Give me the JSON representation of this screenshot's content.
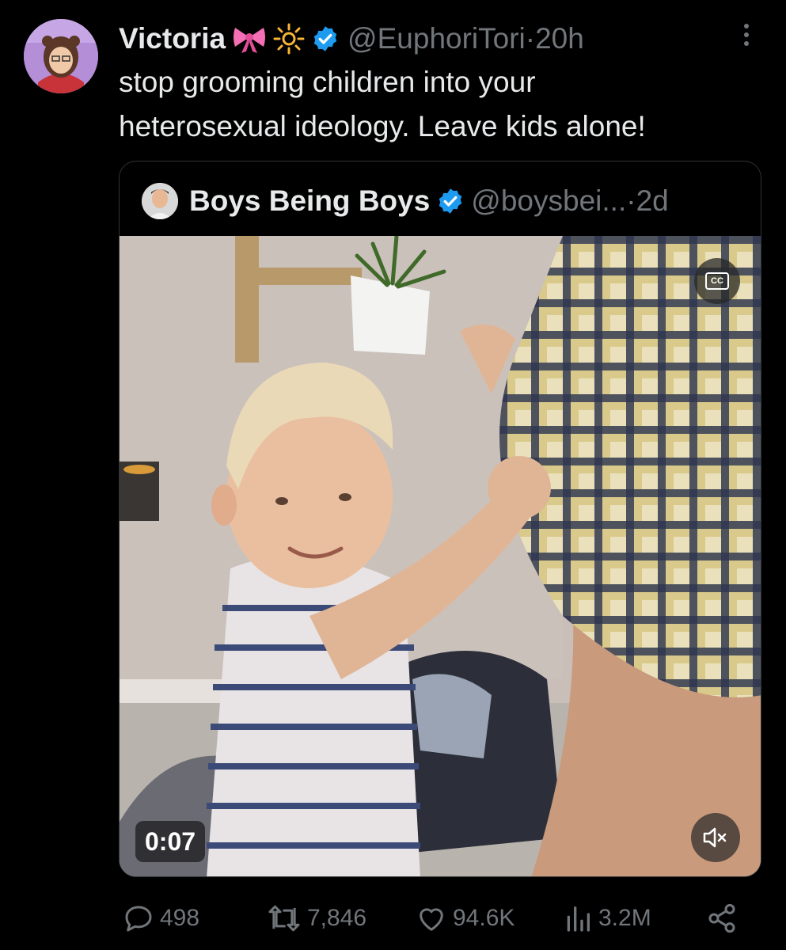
{
  "tweet": {
    "author_name": "Victoria",
    "handle": "@EuphoriTori",
    "separator": " · ",
    "time": "20h",
    "text": "stop grooming children into your\nheterosexual ideology. Leave kids alone!"
  },
  "quote": {
    "author_name": "Boys Being Boys",
    "handle": "@boysbei...",
    "separator": " · ",
    "time": "2d",
    "video": {
      "timestamp": "0:07",
      "cc_label": "CC"
    }
  },
  "actions": {
    "replies": "498",
    "reposts": "7,846",
    "likes": "94.6K",
    "views": "3.2M"
  },
  "icons": {
    "verified": "verified-badge-icon",
    "bow": "ribbon-emoji-icon",
    "sun": "sun-emoji-icon",
    "more": "more-dots-icon",
    "reply": "reply-icon",
    "repost": "repost-icon",
    "like": "heart-icon",
    "views": "views-icon",
    "share": "share-icon",
    "mute": "muted-speaker-icon"
  },
  "colors": {
    "background": "#000000",
    "text": "#e7e9ea",
    "secondary": "#71767b",
    "verified": "#1d9bf0",
    "border": "#2f3336"
  }
}
